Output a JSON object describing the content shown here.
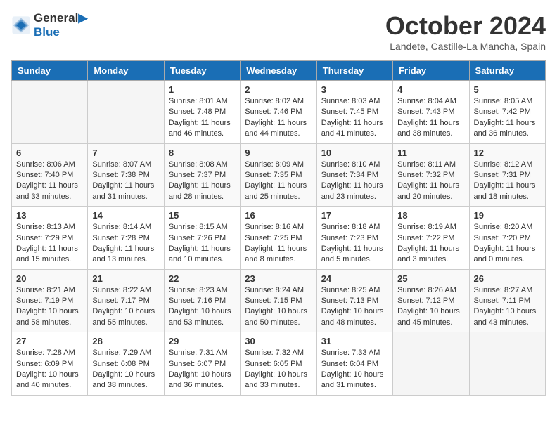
{
  "header": {
    "logo_line1": "General",
    "logo_line2": "Blue",
    "month_title": "October 2024",
    "location": "Landete, Castille-La Mancha, Spain"
  },
  "days_of_week": [
    "Sunday",
    "Monday",
    "Tuesday",
    "Wednesday",
    "Thursday",
    "Friday",
    "Saturday"
  ],
  "weeks": [
    [
      {
        "day": "",
        "info": ""
      },
      {
        "day": "",
        "info": ""
      },
      {
        "day": "1",
        "info": "Sunrise: 8:01 AM\nSunset: 7:48 PM\nDaylight: 11 hours and 46 minutes."
      },
      {
        "day": "2",
        "info": "Sunrise: 8:02 AM\nSunset: 7:46 PM\nDaylight: 11 hours and 44 minutes."
      },
      {
        "day": "3",
        "info": "Sunrise: 8:03 AM\nSunset: 7:45 PM\nDaylight: 11 hours and 41 minutes."
      },
      {
        "day": "4",
        "info": "Sunrise: 8:04 AM\nSunset: 7:43 PM\nDaylight: 11 hours and 38 minutes."
      },
      {
        "day": "5",
        "info": "Sunrise: 8:05 AM\nSunset: 7:42 PM\nDaylight: 11 hours and 36 minutes."
      }
    ],
    [
      {
        "day": "6",
        "info": "Sunrise: 8:06 AM\nSunset: 7:40 PM\nDaylight: 11 hours and 33 minutes."
      },
      {
        "day": "7",
        "info": "Sunrise: 8:07 AM\nSunset: 7:38 PM\nDaylight: 11 hours and 31 minutes."
      },
      {
        "day": "8",
        "info": "Sunrise: 8:08 AM\nSunset: 7:37 PM\nDaylight: 11 hours and 28 minutes."
      },
      {
        "day": "9",
        "info": "Sunrise: 8:09 AM\nSunset: 7:35 PM\nDaylight: 11 hours and 25 minutes."
      },
      {
        "day": "10",
        "info": "Sunrise: 8:10 AM\nSunset: 7:34 PM\nDaylight: 11 hours and 23 minutes."
      },
      {
        "day": "11",
        "info": "Sunrise: 8:11 AM\nSunset: 7:32 PM\nDaylight: 11 hours and 20 minutes."
      },
      {
        "day": "12",
        "info": "Sunrise: 8:12 AM\nSunset: 7:31 PM\nDaylight: 11 hours and 18 minutes."
      }
    ],
    [
      {
        "day": "13",
        "info": "Sunrise: 8:13 AM\nSunset: 7:29 PM\nDaylight: 11 hours and 15 minutes."
      },
      {
        "day": "14",
        "info": "Sunrise: 8:14 AM\nSunset: 7:28 PM\nDaylight: 11 hours and 13 minutes."
      },
      {
        "day": "15",
        "info": "Sunrise: 8:15 AM\nSunset: 7:26 PM\nDaylight: 11 hours and 10 minutes."
      },
      {
        "day": "16",
        "info": "Sunrise: 8:16 AM\nSunset: 7:25 PM\nDaylight: 11 hours and 8 minutes."
      },
      {
        "day": "17",
        "info": "Sunrise: 8:18 AM\nSunset: 7:23 PM\nDaylight: 11 hours and 5 minutes."
      },
      {
        "day": "18",
        "info": "Sunrise: 8:19 AM\nSunset: 7:22 PM\nDaylight: 11 hours and 3 minutes."
      },
      {
        "day": "19",
        "info": "Sunrise: 8:20 AM\nSunset: 7:20 PM\nDaylight: 11 hours and 0 minutes."
      }
    ],
    [
      {
        "day": "20",
        "info": "Sunrise: 8:21 AM\nSunset: 7:19 PM\nDaylight: 10 hours and 58 minutes."
      },
      {
        "day": "21",
        "info": "Sunrise: 8:22 AM\nSunset: 7:17 PM\nDaylight: 10 hours and 55 minutes."
      },
      {
        "day": "22",
        "info": "Sunrise: 8:23 AM\nSunset: 7:16 PM\nDaylight: 10 hours and 53 minutes."
      },
      {
        "day": "23",
        "info": "Sunrise: 8:24 AM\nSunset: 7:15 PM\nDaylight: 10 hours and 50 minutes."
      },
      {
        "day": "24",
        "info": "Sunrise: 8:25 AM\nSunset: 7:13 PM\nDaylight: 10 hours and 48 minutes."
      },
      {
        "day": "25",
        "info": "Sunrise: 8:26 AM\nSunset: 7:12 PM\nDaylight: 10 hours and 45 minutes."
      },
      {
        "day": "26",
        "info": "Sunrise: 8:27 AM\nSunset: 7:11 PM\nDaylight: 10 hours and 43 minutes."
      }
    ],
    [
      {
        "day": "27",
        "info": "Sunrise: 7:28 AM\nSunset: 6:09 PM\nDaylight: 10 hours and 40 minutes."
      },
      {
        "day": "28",
        "info": "Sunrise: 7:29 AM\nSunset: 6:08 PM\nDaylight: 10 hours and 38 minutes."
      },
      {
        "day": "29",
        "info": "Sunrise: 7:31 AM\nSunset: 6:07 PM\nDaylight: 10 hours and 36 minutes."
      },
      {
        "day": "30",
        "info": "Sunrise: 7:32 AM\nSunset: 6:05 PM\nDaylight: 10 hours and 33 minutes."
      },
      {
        "day": "31",
        "info": "Sunrise: 7:33 AM\nSunset: 6:04 PM\nDaylight: 10 hours and 31 minutes."
      },
      {
        "day": "",
        "info": ""
      },
      {
        "day": "",
        "info": ""
      }
    ]
  ]
}
